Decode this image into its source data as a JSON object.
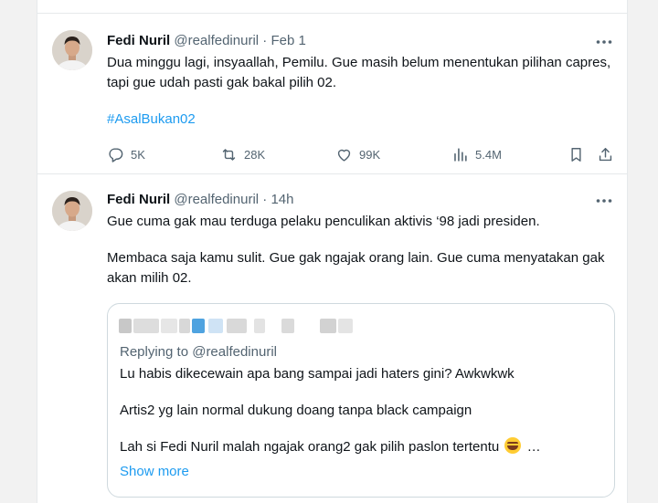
{
  "posts": [
    {
      "author_name": "Fedi Nuril",
      "handle": "@realfedinuril",
      "separator": "·",
      "time": "Feb 1",
      "more_icon": "more-horizontal-icon",
      "paragraphs": [
        "Dua minggu lagi, insyaallah, Pemilu. Gue masih belum menentukan pilihan capres, tapi gue udah pasti gak bakal pilih 02."
      ],
      "hashtag": "#AsalBukan02",
      "stats": {
        "replies": "5K",
        "reposts": "28K",
        "likes": "99K",
        "views": "5.4M"
      }
    },
    {
      "author_name": "Fedi Nuril",
      "handle": "@realfedinuril",
      "separator": "·",
      "time": "14h",
      "more_icon": "more-horizontal-icon",
      "paragraphs": [
        "Gue cuma gak mau terduga pelaku penculikan aktivis ‘98 jadi presiden.",
        "Membaca saja kamu sulit. Gue gak ngajak orang lain. Gue cuma menyatakan gak akan milih 02."
      ],
      "quote": {
        "replying_to": "Replying to @realfedinuril",
        "paragraphs": [
          "Lu habis dikecewain apa bang sampai jadi haters gini? Awkwkwk",
          "Artis2 yg lain normal dukung doang tanpa black campaign",
          "Lah si Fedi Nuril malah ngajak orang2 gak pilih paslon tertentu"
        ],
        "ellipsis": "…",
        "emoji": "rolling-on-floor-laughing-emoji",
        "show_more": "Show more"
      }
    }
  ],
  "colors": {
    "accent": "#1d9bf0",
    "text_primary": "#0f1419",
    "text_secondary": "#536471",
    "border": "#e6e9eb"
  }
}
